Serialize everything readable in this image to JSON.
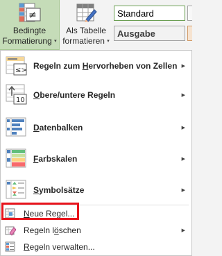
{
  "ribbon": {
    "conditional_formatting": {
      "line1": "Bedingte",
      "line2": "Formatierung",
      "caret": "▾"
    },
    "format_as_table": {
      "line1": "Als Tabelle",
      "line2": "formatieren",
      "caret": "▾"
    },
    "cell_styles": [
      {
        "label": "Standard"
      },
      {
        "label": "Ausgabe"
      }
    ]
  },
  "menu": {
    "items": [
      {
        "pre": "Regeln zum ",
        "key": "H",
        "post": "ervorheben von Zellen",
        "icon": "highlight-cells-icon",
        "has_submenu": true
      },
      {
        "pre": "",
        "key": "O",
        "post": "bere/untere Regeln",
        "icon": "top-bottom-rules-icon",
        "has_submenu": true
      },
      {
        "pre": "",
        "key": "D",
        "post": "atenbalken",
        "icon": "data-bars-icon",
        "has_submenu": true
      },
      {
        "pre": "",
        "key": "F",
        "post": "arbskalen",
        "icon": "color-scales-icon",
        "has_submenu": true
      },
      {
        "pre": "",
        "key": "S",
        "post": "ymbolsätze",
        "icon": "icon-sets-icon",
        "has_submenu": true
      },
      {
        "pre": "",
        "key": "N",
        "post": "eue Regel...",
        "icon": "new-rule-icon",
        "has_submenu": false
      },
      {
        "pre": "Regeln l",
        "key": "ö",
        "post": "schen",
        "icon": "clear-rules-icon",
        "has_submenu": true
      },
      {
        "pre": "",
        "key": "R",
        "post": "egeln verwalten...",
        "icon": "manage-rules-icon",
        "has_submenu": false
      }
    ],
    "submenu_arrow": "▶",
    "highlight_color": "#e8141c"
  }
}
